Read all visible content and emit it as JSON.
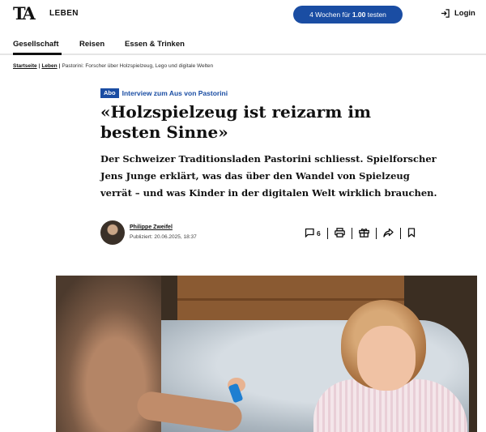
{
  "header": {
    "logo_text": "TA",
    "section": "LEBEN",
    "cta_prefix": "4 Wochen für ",
    "cta_price": "1.00",
    "cta_suffix": " testen",
    "login_label": "Login"
  },
  "nav": {
    "items": [
      {
        "label": "Gesellschaft"
      },
      {
        "label": "Reisen"
      },
      {
        "label": "Essen & Trinken"
      }
    ]
  },
  "breadcrumb": {
    "home": "Startseite",
    "section": "Leben",
    "separator": "|",
    "current": "Pastorini: Forscher über Holzspielzeug, Lego und digitale Welten"
  },
  "article": {
    "abo_badge": "Abo",
    "kicker": "Interview zum Aus von Pastorini",
    "headline": "«Holzspielzeug ist reizarm im besten Sinne»",
    "lead": "Der Schweizer Traditionsladen Pastorini schliesst. Spielforscher Jens Junge erklärt, was das über den Wandel von Spielzeug verrät – und was Kinder in der digitalen Welt wirklich brauchen.",
    "author": "Philippe Zweifel",
    "published": "Publiziert: 20.06.2025, 18:37",
    "comment_count": "6"
  },
  "icons": {
    "login": "login-icon",
    "comments": "comment-icon",
    "print": "print-icon",
    "gift": "gift-icon",
    "share": "share-icon",
    "bookmark": "bookmark-icon"
  },
  "colors": {
    "accent": "#1a4da3"
  }
}
